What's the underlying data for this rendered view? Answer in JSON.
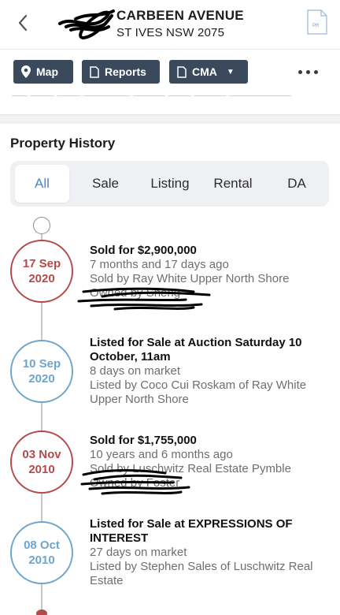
{
  "header": {
    "street": "CARBEEN AVENUE",
    "suburb": "ST IVES NSW 2075",
    "back_icon": "chevron-left-icon",
    "pdf_icon": "pdf-document-icon",
    "pdf_label": "PR"
  },
  "toolbar": {
    "map_label": "Map",
    "reports_label": "Reports",
    "cma_label": "CMA",
    "more_icon": "more-horizontal-icon",
    "button_color": "#3a4a5c"
  },
  "history": {
    "title": "Property History",
    "tabs": [
      "All",
      "Sale",
      "Listing",
      "Rental",
      "DA"
    ],
    "active_tab": "All",
    "events": [
      {
        "type": "sold",
        "day_month": "17 Sep",
        "year": "2020",
        "title": "Sold for $2,900,000",
        "line1": "7 months and 17 days ago",
        "line2": "Sold by Ray White Upper North Shore",
        "line3": "Owned by Sheng"
      },
      {
        "type": "listed",
        "day_month": "10 Sep",
        "year": "2020",
        "title": "Listed for Sale at Auction Saturday 10 October, 11am",
        "line1": "8 days on market",
        "line2": "Listed by Coco Cui Roskam of Ray White Upper North Shore"
      },
      {
        "type": "sold",
        "day_month": "03 Nov",
        "year": "2010",
        "title": "Sold for $1,755,000",
        "line1": "10 years and 6 months ago",
        "line2": "Sold by Luschwitz Real Estate Pymble",
        "line3": "Owned by Foster"
      },
      {
        "type": "listed",
        "day_month": "08 Oct",
        "year": "2010",
        "title": "Listed for Sale at EXPRESSIONS OF INTEREST",
        "line1": "27 days on market",
        "line2": "Listed by Stephen Sales of Luschwitz Real Estate"
      }
    ]
  },
  "colors": {
    "sold": "#b54a4a",
    "listed": "#6ea5cc",
    "active_tab": "#4a86c7"
  }
}
